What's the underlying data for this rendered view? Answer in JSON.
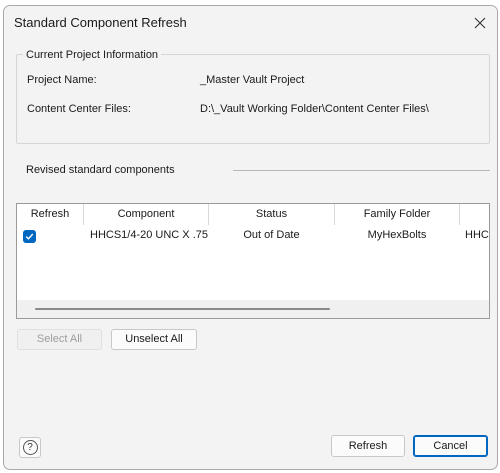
{
  "window": {
    "title": "Standard Component Refresh"
  },
  "project_info": {
    "legend": "Current Project Information",
    "project_name_label": "Project Name:",
    "project_name_value": "_Master Vault Project",
    "content_center_label": "Content Center Files:",
    "content_center_value": "D:\\_Vault Working Folder\\Content Center Files\\"
  },
  "revised": {
    "label": "Revised standard components"
  },
  "grid": {
    "columns": [
      "Refresh",
      "Component",
      "Status",
      "Family Folder",
      ""
    ],
    "rows": [
      {
        "refresh_checked": true,
        "component": "HHCS1/4-20 UNC X .75...",
        "status": "Out of Date",
        "family_folder": "MyHexBolts",
        "extra": "HHCS"
      }
    ]
  },
  "buttons": {
    "select_all": "Select All",
    "unselect_all": "Unselect All",
    "refresh": "Refresh",
    "cancel": "Cancel",
    "help": "?"
  },
  "colors": {
    "accent": "#0067c0",
    "background": "#f3f3f3"
  }
}
